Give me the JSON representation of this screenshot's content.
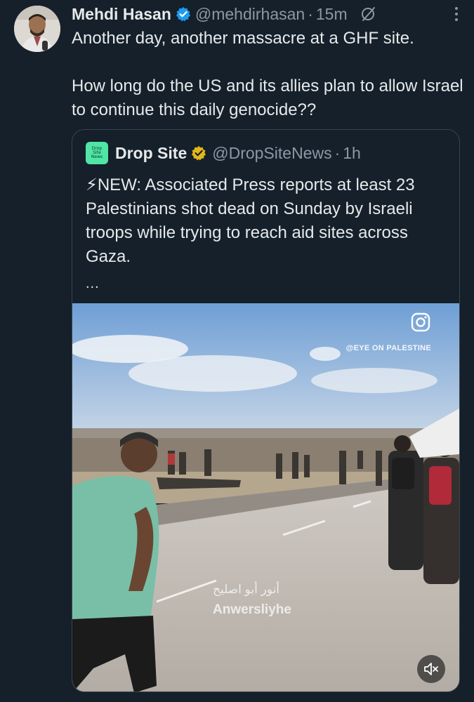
{
  "author": {
    "name": "Mehdi Hasan",
    "handle": "@mehdirhasan",
    "separator": "·",
    "time": "15m",
    "verified_color": "#1d9bf0"
  },
  "tweet": {
    "paragraphs": [
      "Another day, another massacre at a GHF site.",
      "How long do the US and its allies plan to allow Israel to continue this daily genocide??"
    ]
  },
  "quoted": {
    "logo_text": [
      "Drop",
      "Site",
      "News"
    ],
    "name": "Drop Site",
    "handle": "@DropSiteNews",
    "separator": "·",
    "time": "1h",
    "badge_color": "#e2b719",
    "text": "⚡NEW: Associated Press reports at least 23 Palestinians shot dead on Sunday by Israeli troops while trying to reach aid sites across Gaza.",
    "more": "...",
    "media": {
      "watermark": "@EYE ON PALESTINE",
      "credit_arabic": "أنور أبو اصليح",
      "credit_latin": "Anwersliyhe",
      "mute_icon": "speaker-muted-icon",
      "instagram_icon": "instagram-icon"
    }
  },
  "icons": {
    "more": "more-options-icon",
    "grok": "grok-icon",
    "verified": "verified-badge-icon"
  }
}
